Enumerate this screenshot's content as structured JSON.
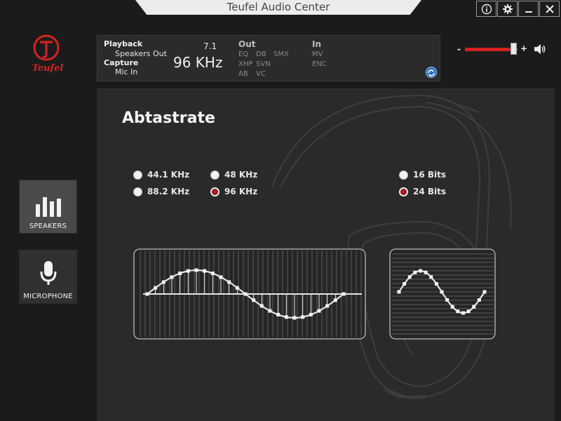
{
  "window": {
    "title": "Teufel Audio Center",
    "buttons": [
      "info",
      "settings",
      "minimize",
      "close"
    ]
  },
  "logo": {
    "brand": "Teufel",
    "letter": "T",
    "color": "#d62222"
  },
  "status": {
    "playback_label": "Playback",
    "playback_device": "Speakers Out",
    "capture_label": "Capture",
    "capture_device": "Mic In",
    "channels": "7.1",
    "rate": "96 KHz",
    "out_label": "Out",
    "out_items": [
      "EQ",
      "DB",
      "SMX",
      "XHP",
      "SVN",
      "AB",
      "VC"
    ],
    "in_label": "In",
    "in_items": [
      "MV",
      "ENC"
    ]
  },
  "volume": {
    "minus": "-",
    "plus": "+",
    "level": 0.85,
    "accent": "#d42020"
  },
  "sidebar": {
    "items": [
      {
        "label": "SPEAKERS",
        "icon": "speakers-bars-icon",
        "active": true
      },
      {
        "label": "MICROPHONE",
        "icon": "microphone-icon",
        "active": false
      }
    ]
  },
  "main": {
    "title": "Abtastrate",
    "sample_rates": [
      {
        "label": "44.1 KHz",
        "selected": false
      },
      {
        "label": "48 KHz",
        "selected": false
      },
      {
        "label": "88.2 KHz",
        "selected": false
      },
      {
        "label": "96 KHz",
        "selected": true
      }
    ],
    "bit_depths": [
      {
        "label": "16 Bits",
        "selected": false
      },
      {
        "label": "24 Bits",
        "selected": true
      }
    ]
  }
}
